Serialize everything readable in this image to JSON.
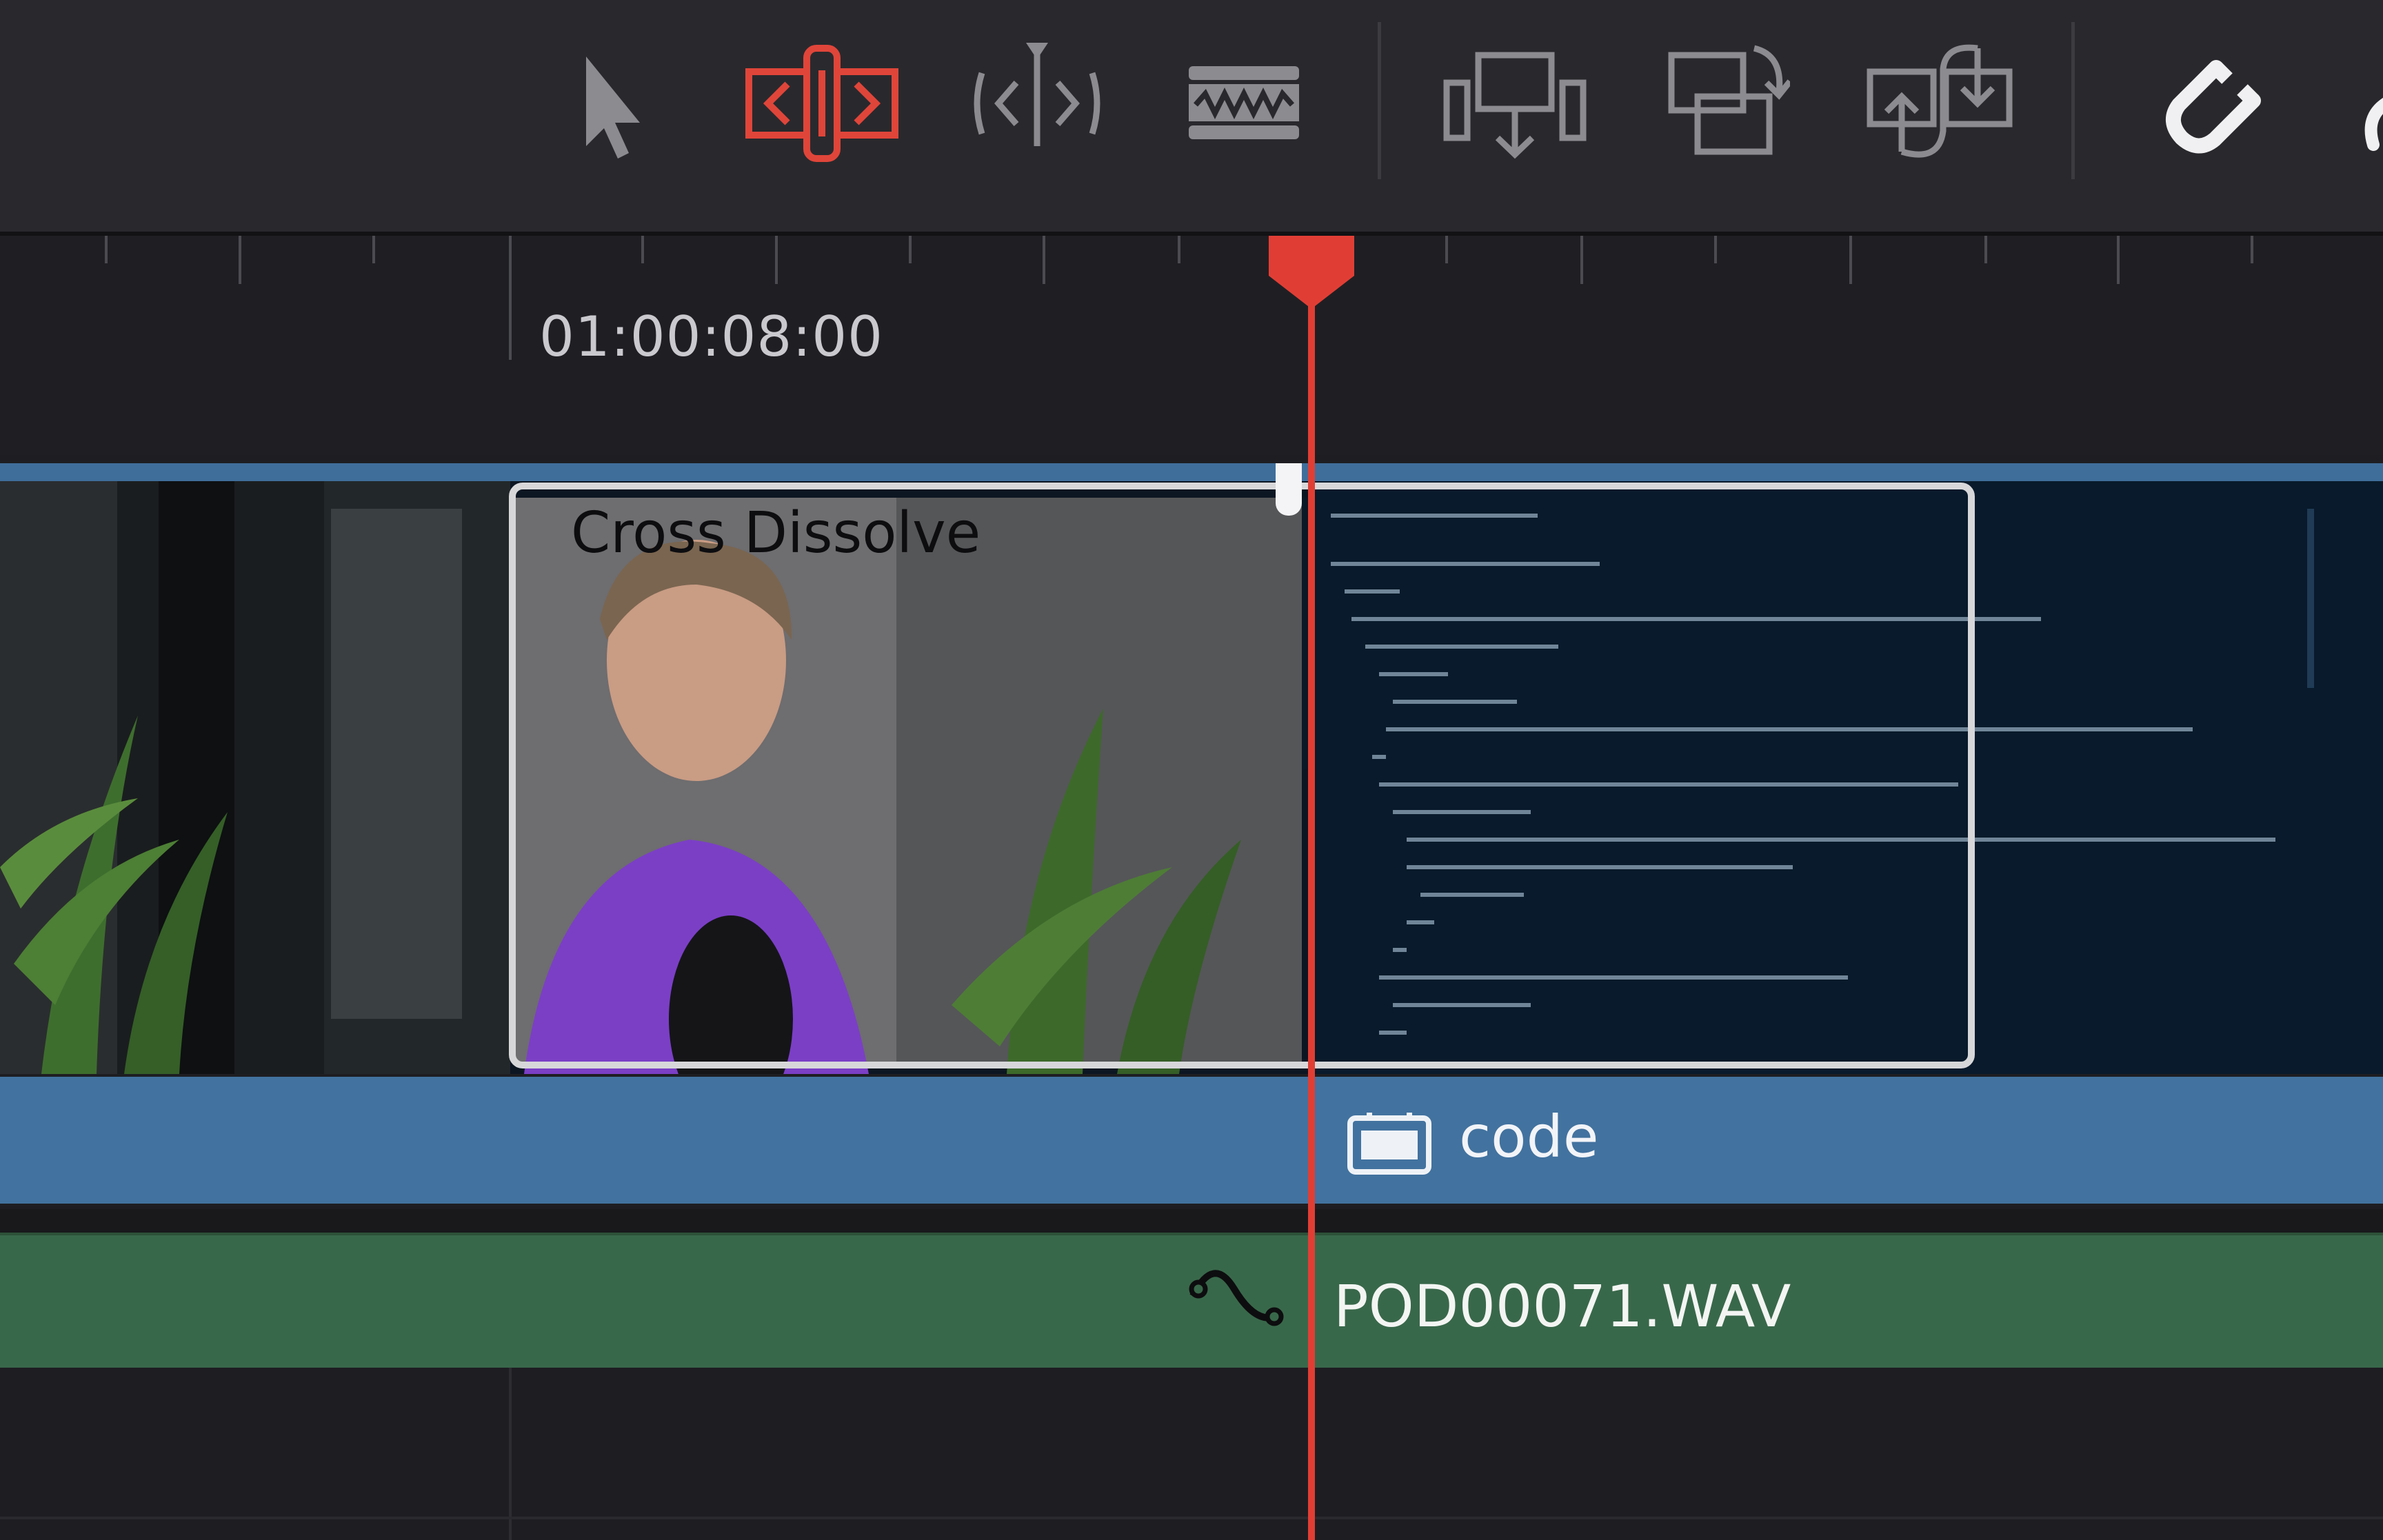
{
  "toolbar": {
    "tools": [
      {
        "icon": "selection-arrow-icon",
        "state": "inactive"
      },
      {
        "icon": "trim-edit-icon",
        "state": "active"
      },
      {
        "icon": "dynamic-trim-icon",
        "state": "inactive"
      },
      {
        "icon": "blade-edit-icon",
        "state": "inactive"
      },
      {
        "icon": "insert-clip-icon",
        "state": "inactive"
      },
      {
        "icon": "overwrite-clip-icon",
        "state": "inactive"
      },
      {
        "icon": "replace-clip-icon",
        "state": "inactive"
      },
      {
        "icon": "snapping-magnet-icon",
        "state": "inactive"
      }
    ],
    "active_color": "#e0453a"
  },
  "ruler": {
    "timecode": "01:00:08:00"
  },
  "timeline": {
    "transition_label": "Cross Dissolve",
    "video_clip_label": "code",
    "audio_clip_label": "POD00071.WAV",
    "colors": {
      "video_track": "#42729f",
      "audio_track": "#38684a",
      "playhead": "#e03e35"
    }
  }
}
